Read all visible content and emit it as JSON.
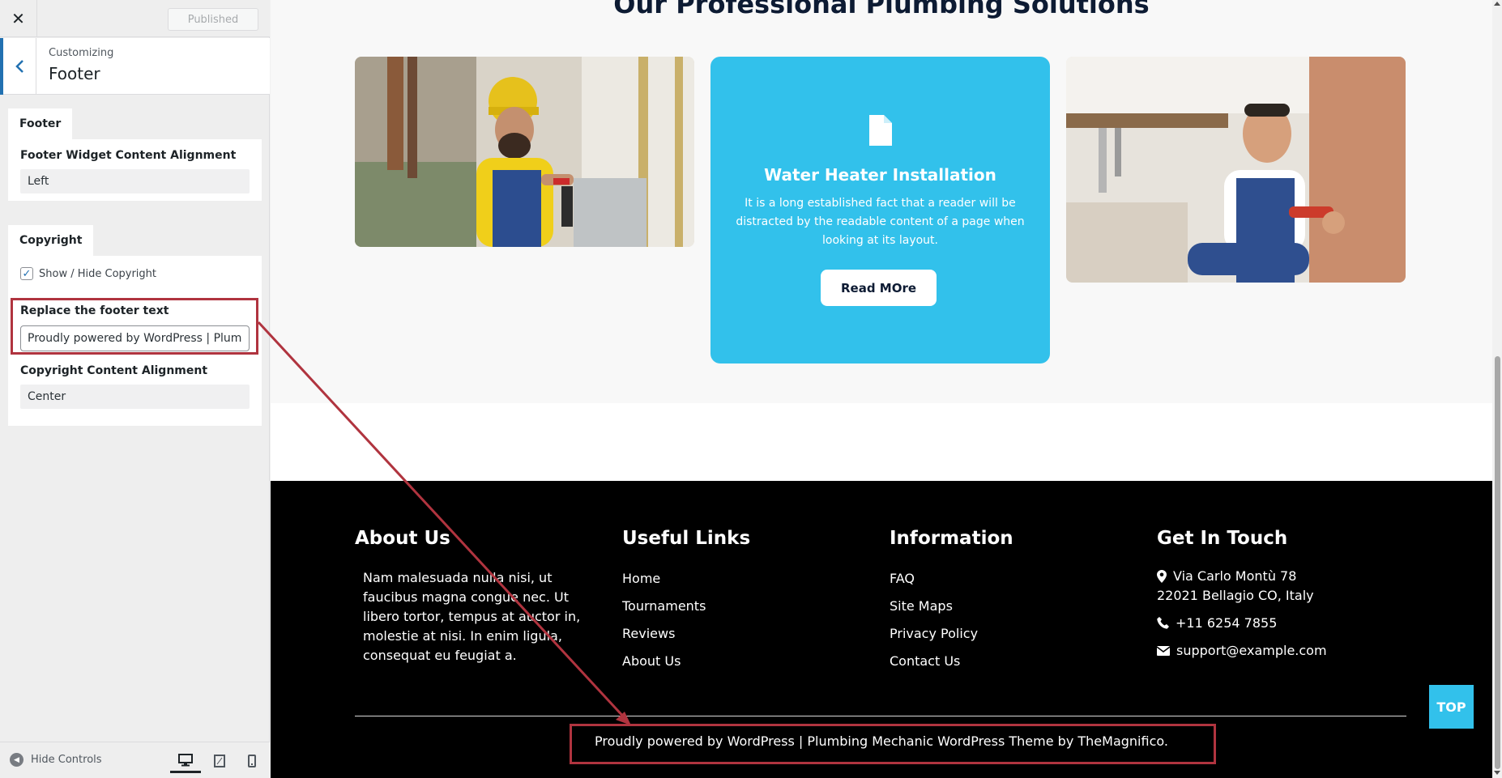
{
  "customizer": {
    "close_glyph": "✕",
    "published_label": "Published",
    "header_subtitle": "Customizing",
    "header_title": "Footer",
    "footer_section": {
      "tab_label": "Footer",
      "alignment_label": "Footer Widget Content Alignment",
      "alignment_value": "Left"
    },
    "copyright_section": {
      "tab_label": "Copyright",
      "show_hide_label": "Show / Hide Copyright",
      "show_hide_checked": true,
      "replace_text_label": "Replace the footer text",
      "replace_text_value": "Proudly powered by WordPress | Plumbing",
      "content_alignment_label": "Copyright Content Alignment",
      "content_alignment_value": "Center"
    },
    "hide_controls_label": "Hide Controls",
    "devices": [
      "desktop",
      "tablet",
      "mobile"
    ]
  },
  "preview": {
    "section_title": "Our Professional Plumbing Solutions",
    "service_card": {
      "icon": "document-icon",
      "title": "Water Heater Installation",
      "text": "It is a long established fact that a reader will be distracted by the readable content of a page when looking at its layout.",
      "button_label": "Read MOre"
    },
    "footer": {
      "about": {
        "heading": "About Us",
        "text": "Nam malesuada nulla nisi, ut faucibus magna congue nec. Ut libero tortor, tempus at auctor in, molestie at nisi. In enim ligula, consequat eu feugiat a."
      },
      "useful_links": {
        "heading": "Useful Links",
        "items": [
          "Home",
          "Tournaments",
          "Reviews",
          "About Us"
        ]
      },
      "information": {
        "heading": "Information",
        "items": [
          "FAQ",
          "Site Maps",
          "Privacy Policy",
          "Contact Us"
        ]
      },
      "get_in_touch": {
        "heading": "Get In Touch",
        "address_line1": "Via Carlo Montù 78",
        "address_line2": "22021 Bellagio CO, Italy",
        "phone": "+11 6254 7855",
        "email": "support@example.com"
      },
      "copyright_text": "Proudly powered by WordPress | Plumbing Mechanic WordPress Theme by TheMagnifico.",
      "top_button": "TOP"
    }
  },
  "colors": {
    "accent_blue": "#32c1eb",
    "wp_blue": "#2271b1",
    "highlight_red": "#b0343f",
    "footer_bg": "#000000"
  }
}
